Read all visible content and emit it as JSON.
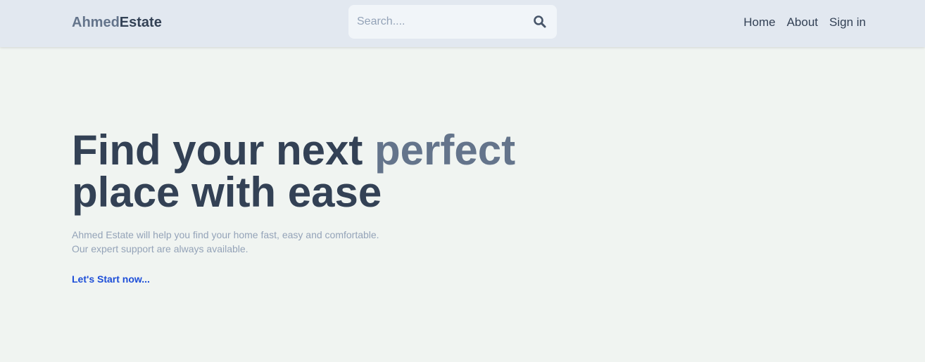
{
  "header": {
    "logo_first": "Ahmed",
    "logo_second": "Estate",
    "search": {
      "placeholder": "Search...."
    },
    "search_icon": "search-icon",
    "nav": [
      {
        "label": "Home"
      },
      {
        "label": "About"
      },
      {
        "label": "Sign in"
      }
    ]
  },
  "hero": {
    "title_start": "Find your next ",
    "title_accent": "perfect",
    "title_end": "place with ease",
    "subtitle_line1": "Ahmed Estate will help you find your home fast, easy and comfortable.",
    "subtitle_line2": "Our expert support are always available.",
    "cta": "Let's Start now..."
  },
  "colors": {
    "header_bg": "#e2e8f0",
    "page_bg": "#f0f4f1",
    "text_dark": "#334155",
    "text_muted": "#64748b",
    "text_light": "#94a3b8",
    "link": "#1d4ed8"
  }
}
